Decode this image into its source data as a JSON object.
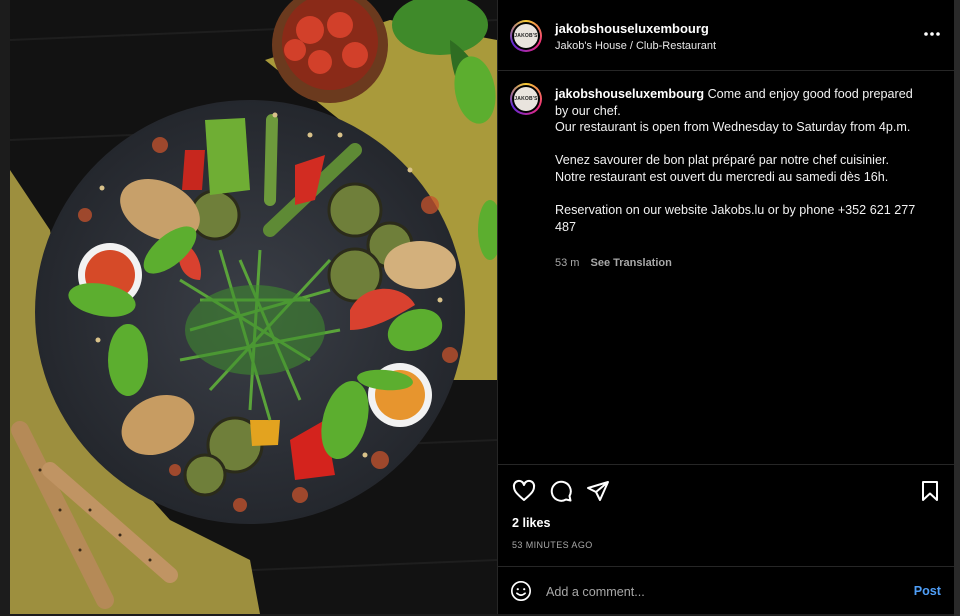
{
  "post": {
    "username": "jakobshouseluxembourg",
    "location": "Jakob's House / Club-Restaurant",
    "avatar_text": "JAKOB'S",
    "caption_intro": "Come and enjoy good food prepared by our chef.",
    "caption_lines": [
      "Our restaurant is open from Wednesday to Saturday from 4p.m.",
      "",
      "Venez savourer de bon plat préparé par notre chef cuisinier.",
      "Notre restaurant est ouvert du mercredi au samedi dès 16h.",
      "",
      "Reservation on our website Jakobs.lu or by phone +352 621 277 487"
    ],
    "caption_age": "53 m",
    "see_translation": "See Translation",
    "likes": "2 likes",
    "posted_ago": "53 MINUTES AGO"
  },
  "comment": {
    "placeholder": "Add a comment...",
    "post_label": "Post"
  },
  "icons": {
    "more": "more-options-icon",
    "like": "heart-icon",
    "comment": "comment-icon",
    "share": "share-icon",
    "save": "bookmark-icon",
    "emoji": "emoji-icon"
  },
  "colors": {
    "background": "#000000",
    "link_blue": "#4f9ef7",
    "secondary_text": "#a8a8a8"
  }
}
